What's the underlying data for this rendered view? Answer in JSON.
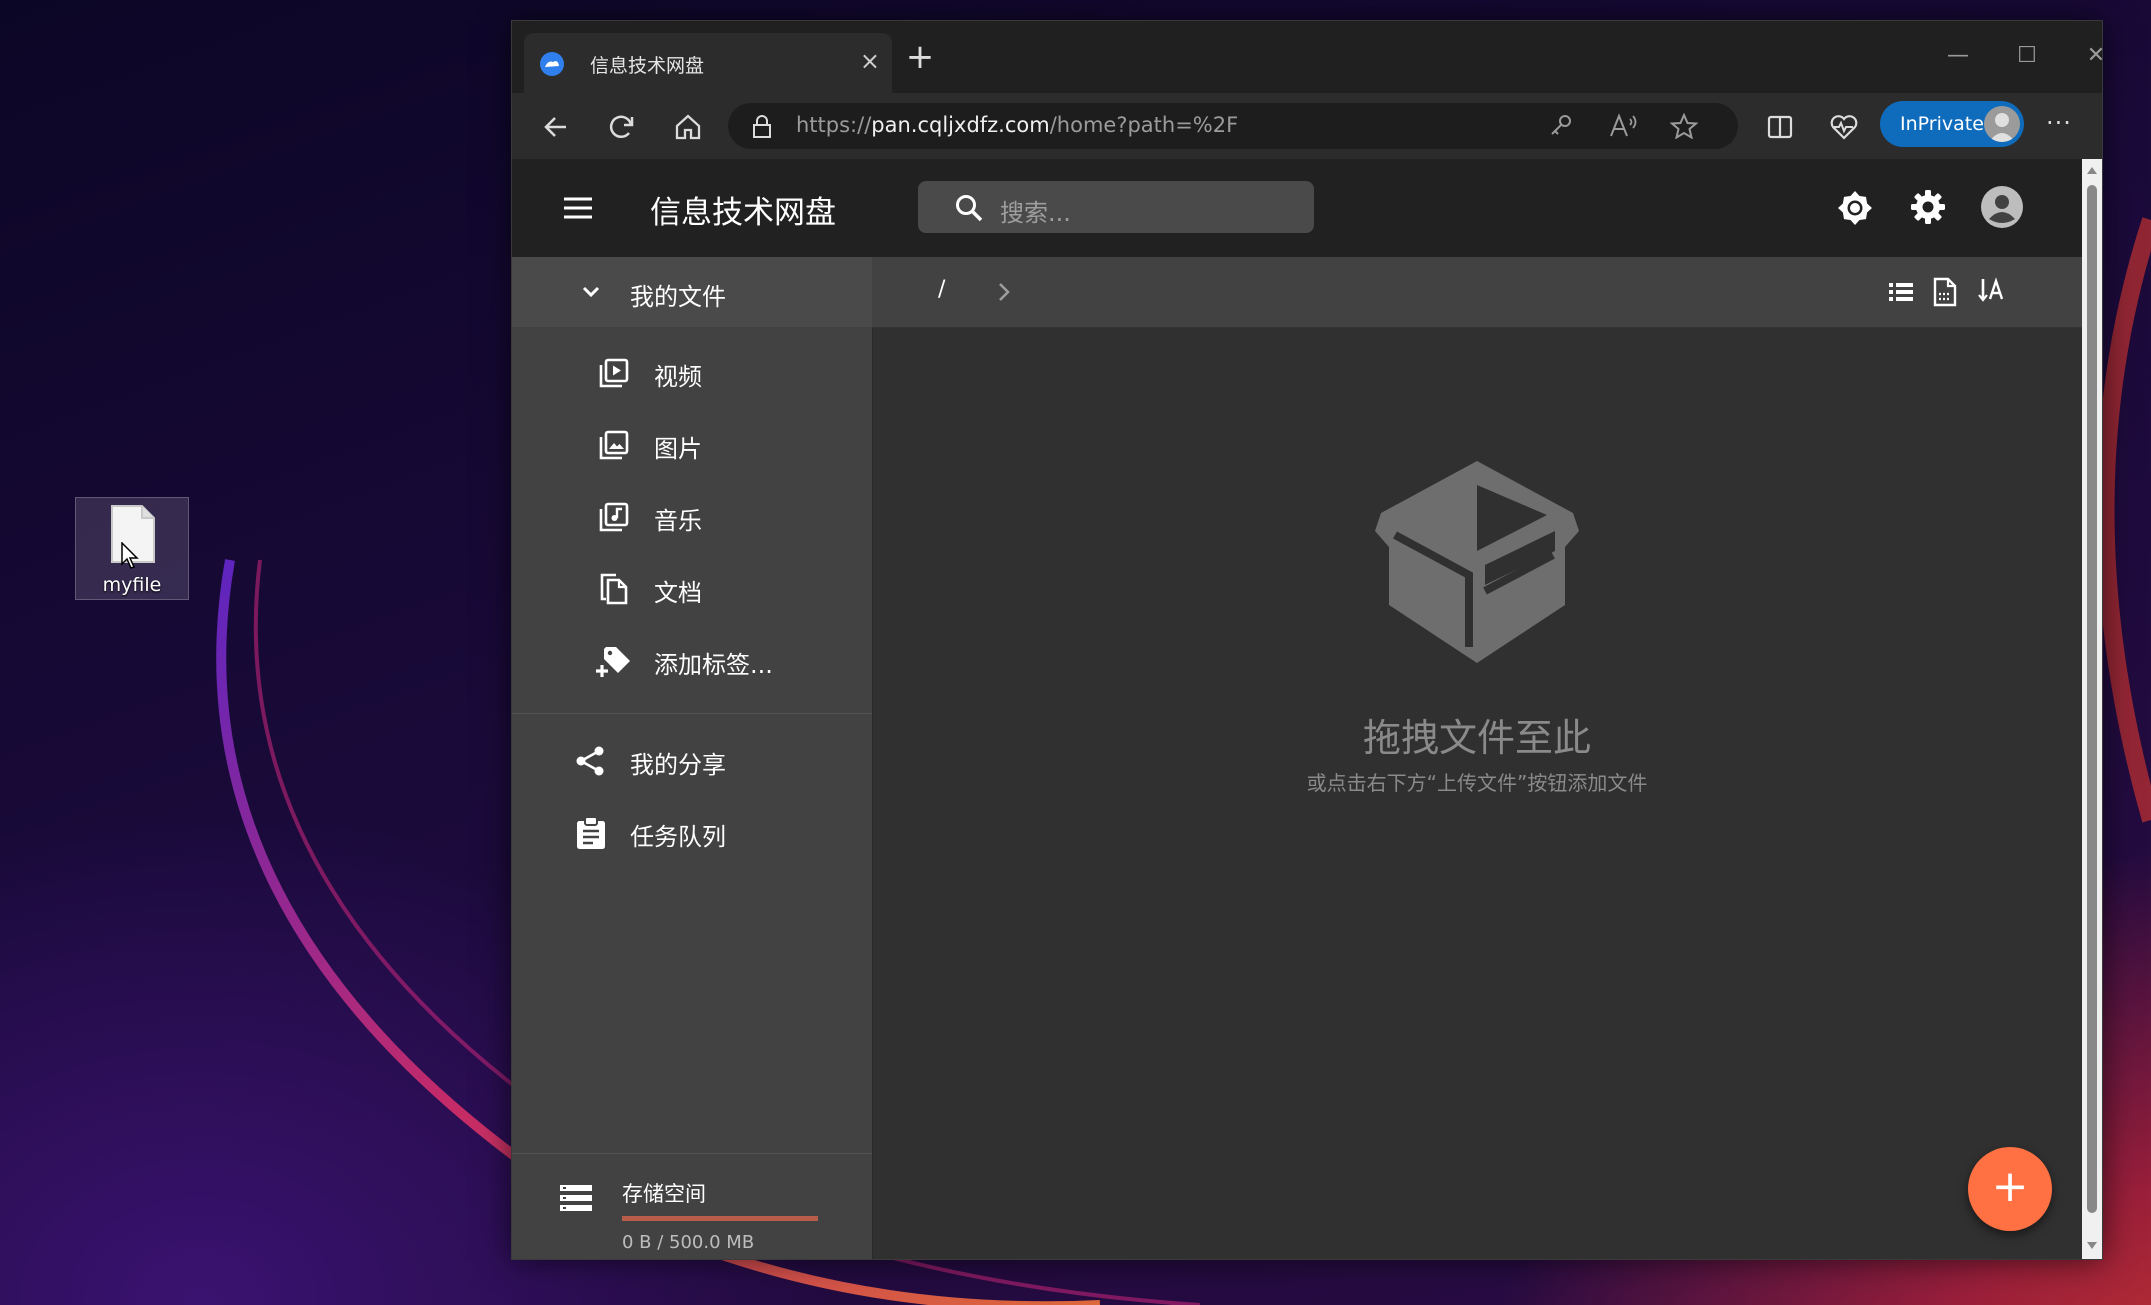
{
  "desktop": {
    "file_label": "myfile"
  },
  "browser": {
    "tab_title": "信息技术网盘",
    "tab_close": "×",
    "new_tab": "+",
    "window_controls": [
      "—",
      "☐",
      "✕"
    ],
    "url_prefix": "https://",
    "url_host": "pan.cqljxdfz.com",
    "url_path": "/home?path=%2F",
    "inprivate_label": "InPrivate",
    "more_label": "···"
  },
  "app": {
    "title": "信息技术网盘",
    "search_placeholder": "搜索...",
    "sidebar": {
      "my_files": "我的文件",
      "categories": [
        {
          "label": "视频",
          "icon": "video-library-icon"
        },
        {
          "label": "图片",
          "icon": "photo-library-icon"
        },
        {
          "label": "音乐",
          "icon": "library-music-icon"
        },
        {
          "label": "文档",
          "icon": "file-copy-icon"
        },
        {
          "label": "添加标签...",
          "icon": "add-tag-icon"
        }
      ],
      "my_share": "我的分享",
      "task_queue": "任务队列",
      "storage_title": "存储空间",
      "storage_usage": "0 B / 500.0 MB",
      "storage_used_fraction": 0
    },
    "breadcrumb_root": "/",
    "empty_title": "拖拽文件至此",
    "empty_subtitle": "或点击右下方“上传文件”按钮添加文件",
    "fab_label": "+",
    "colors": {
      "accent": "#ff7043",
      "appbar": "#212121",
      "sidebar": "#424242",
      "content": "#303030",
      "inprivate": "#0f6cbd"
    }
  }
}
